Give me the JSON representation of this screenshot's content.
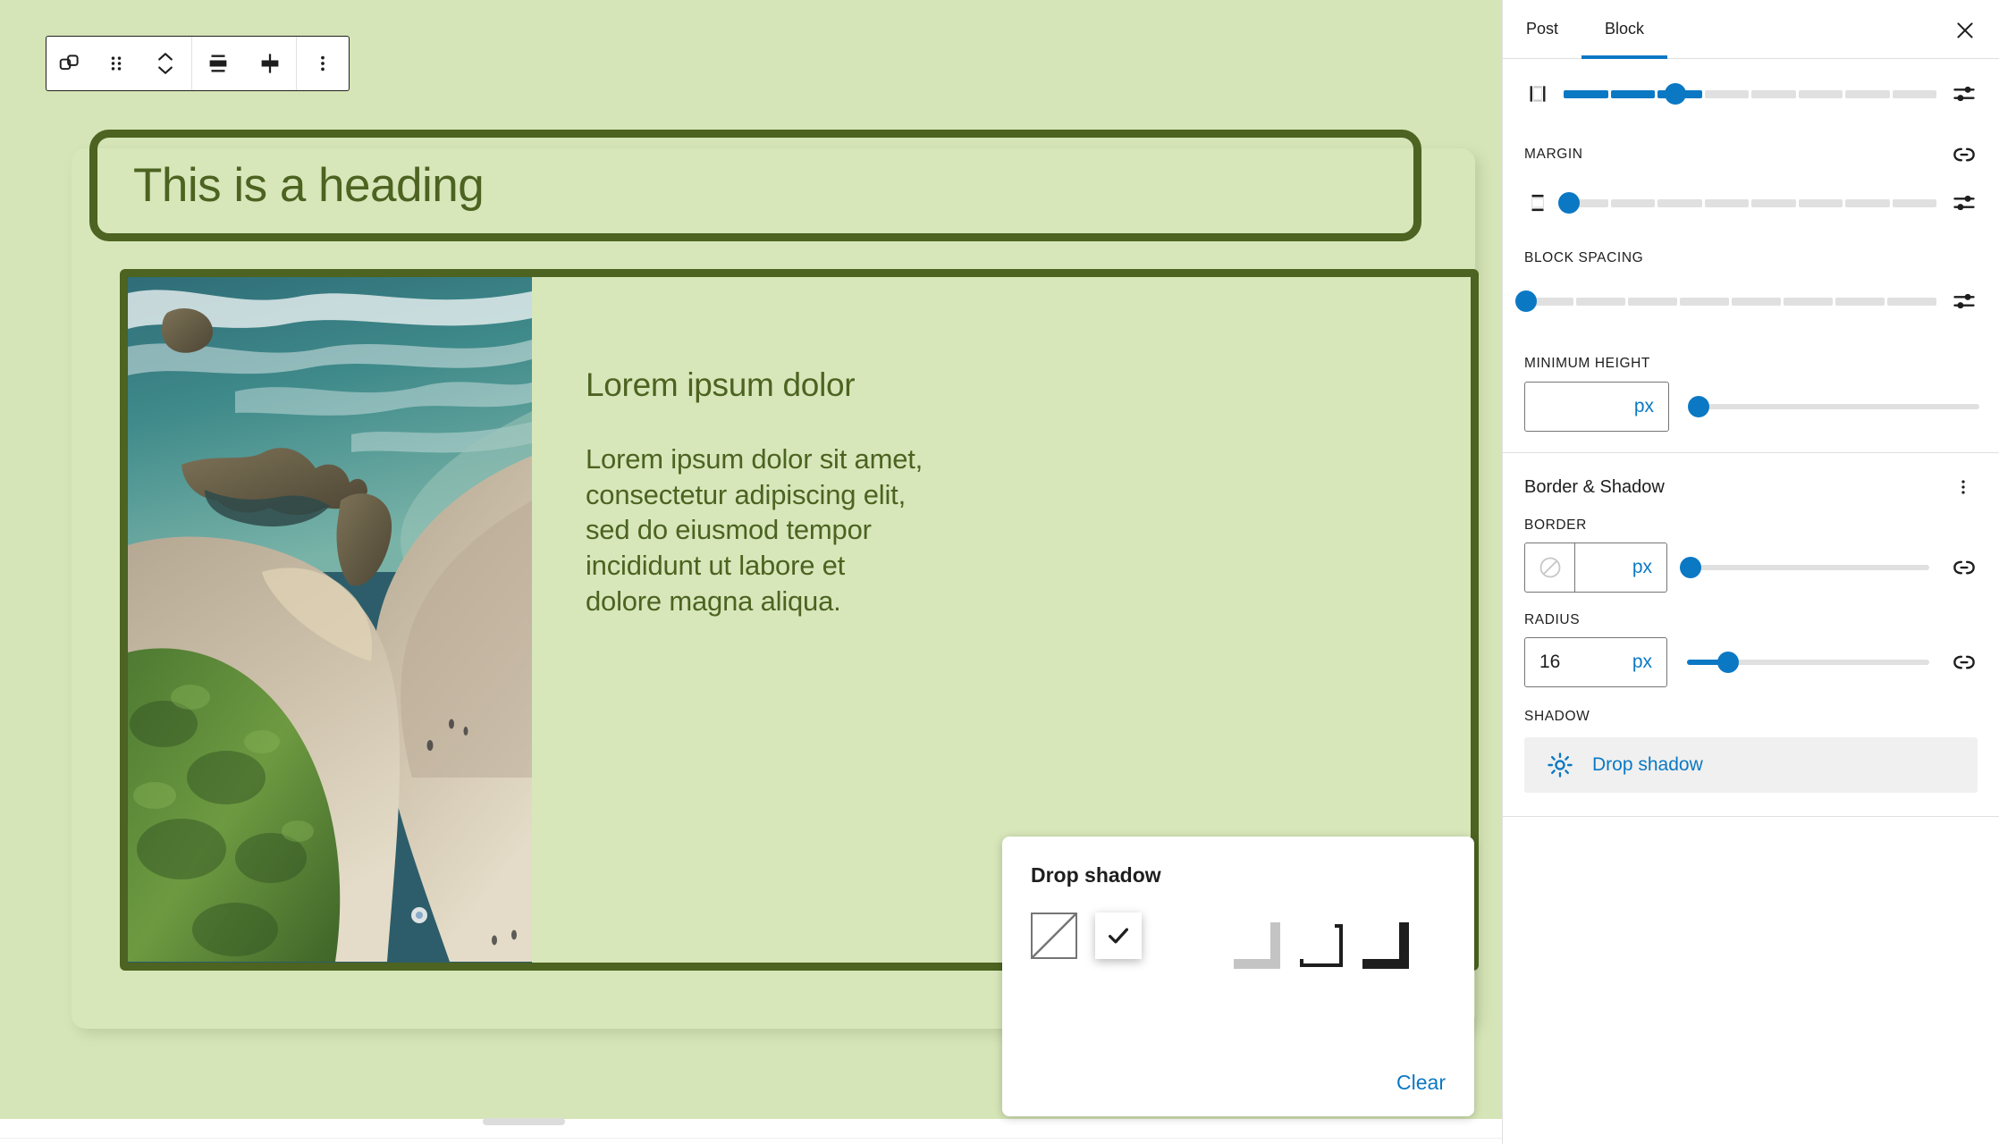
{
  "editor": {
    "toolbar": {
      "buttons": [
        {
          "name": "block-type-group",
          "icon": "group-block-icon",
          "label": "Group"
        },
        {
          "name": "drag-handle",
          "icon": "drag-handle-icon",
          "label": "Drag"
        },
        {
          "name": "move-updown",
          "icon": "chevron-up-down-icon",
          "label": "Move up or down"
        },
        {
          "name": "vertical-align",
          "icon": "align-vertical-center-icon",
          "label": "Change vertical alignment"
        },
        {
          "name": "justify-stretch",
          "icon": "stretch-icon",
          "label": "Change items justification"
        },
        {
          "name": "more-options",
          "icon": "kebab-vertical-icon",
          "label": "Options"
        }
      ]
    },
    "heading": {
      "text": "This is a heading"
    },
    "media_text": {
      "image_alt": "Aerial view of a beach with rocks, surf and green headland",
      "heading": "Lorem ipsum dolor",
      "paragraph": "Lorem ipsum dolor sit amet, consectetur adipiscing elit, sed do eiusmod tempor incididunt ut labore et dolore magna aliqua."
    },
    "colors": {
      "canvas_background": "#d6e5b7",
      "group_background": "#d8e7ba",
      "block_border": "#4c6321",
      "text_green": "#4c6321",
      "accent_blue": "#0b78c4"
    }
  },
  "sidebar": {
    "tabs": [
      {
        "label": "Post",
        "active": false
      },
      {
        "label": "Block",
        "active": true
      }
    ],
    "close_label": "Close Settings",
    "dimensions": {
      "padding": {
        "icon": "padding-sides-icon",
        "segments": 8,
        "filled": 3,
        "knob_percent": 30
      },
      "margin_label": "MARGIN",
      "margin": {
        "icon": "margin-vertical-icon",
        "segments": 8,
        "filled": 0,
        "knob_percent": 1.5
      },
      "block_spacing_label": "BLOCK SPACING",
      "block_spacing": {
        "segments": 8,
        "filled": 0,
        "knob_percent": 0
      },
      "minimum_height_label": "MINIMUM HEIGHT",
      "minimum_height": {
        "value": "",
        "unit": "px",
        "knob_percent": 1.5
      }
    },
    "border_shadow": {
      "title": "Border & Shadow",
      "menu_icon": "kebab-vertical-icon",
      "border_label": "BORDER",
      "border": {
        "swatch_icon": "no-color-icon",
        "value": "",
        "unit": "px",
        "knob_percent": 1.5
      },
      "radius_label": "RADIUS",
      "radius": {
        "value": "16",
        "unit": "px",
        "knob_percent": 17
      },
      "shadow_label": "SHADOW",
      "shadow_value": {
        "icon": "shadow-sun-icon",
        "label": "Drop shadow"
      }
    }
  },
  "popover": {
    "title": "Drop shadow",
    "clear_label": "Clear",
    "swatches": [
      {
        "name": "shadow-none",
        "style": "none",
        "selected": false
      },
      {
        "name": "shadow-natural",
        "style": "check",
        "selected": true
      },
      {
        "name": "shadow-deep",
        "style": "plain",
        "selected": false
      },
      {
        "name": "shadow-sharp",
        "style": "soft",
        "selected": false
      },
      {
        "name": "shadow-outlined",
        "style": "outline",
        "selected": false
      },
      {
        "name": "shadow-crisp",
        "style": "solid",
        "selected": false
      }
    ]
  }
}
